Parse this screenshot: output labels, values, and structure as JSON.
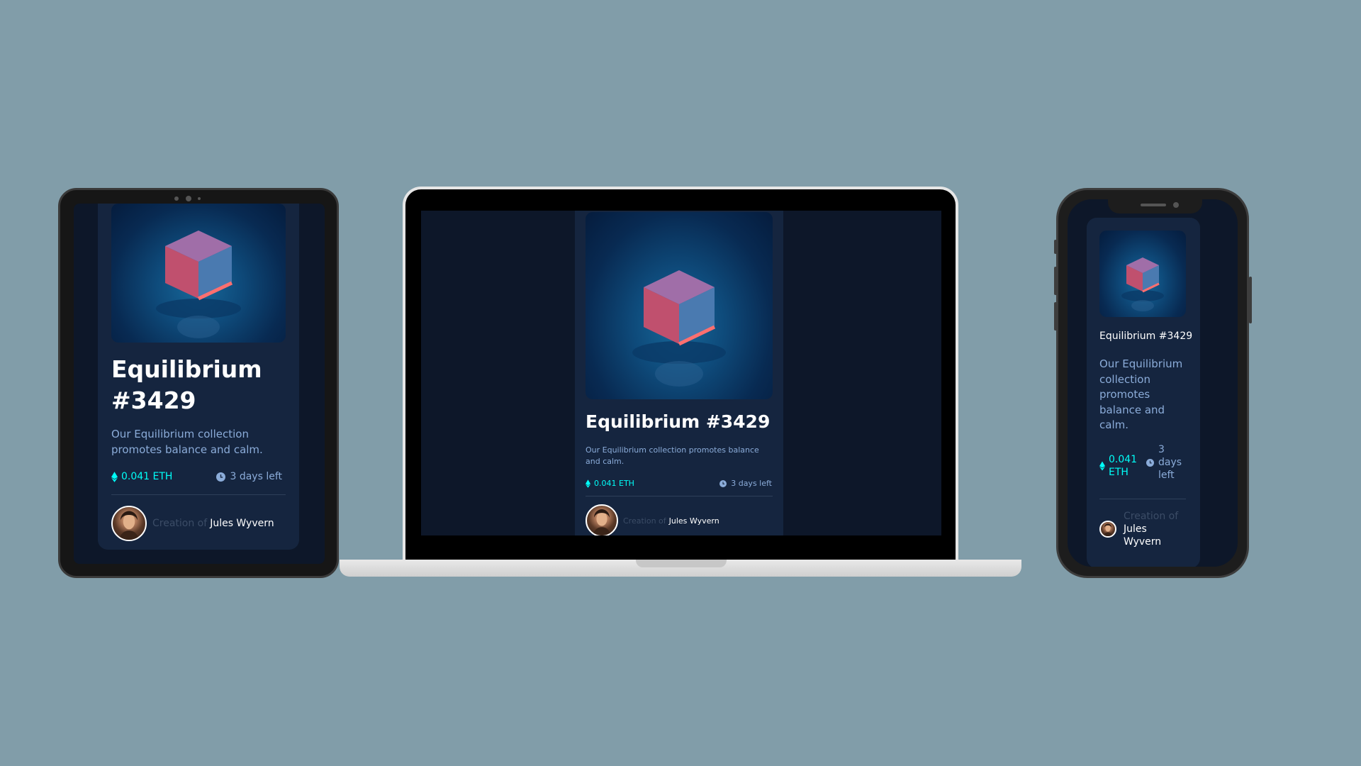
{
  "colors": {
    "background": "#819da9",
    "screen": "#0d1729",
    "card": "#15253f",
    "cyan": "#00fff8",
    "soft_blue": "#8bacd9",
    "white": "#ffffff",
    "line": "#2e405a"
  },
  "nft": {
    "title": "Equilibrium #3429",
    "description": "Our Equilibrium collection promotes balance and calm.",
    "price": "0.041 ETH",
    "time_left": "3 days left",
    "creation_prefix": "Creation of",
    "creator_name": "Jules Wyvern"
  },
  "icons": {
    "price": "ethereum-icon",
    "time": "clock-icon",
    "image": "cube-artwork"
  },
  "phone": {
    "price_line1": "0.041",
    "price_line2": "ETH",
    "time_line1": "3",
    "time_line2": "days",
    "time_line3": "left",
    "creator_line1": "Jules",
    "creator_line2": "Wyvern"
  }
}
